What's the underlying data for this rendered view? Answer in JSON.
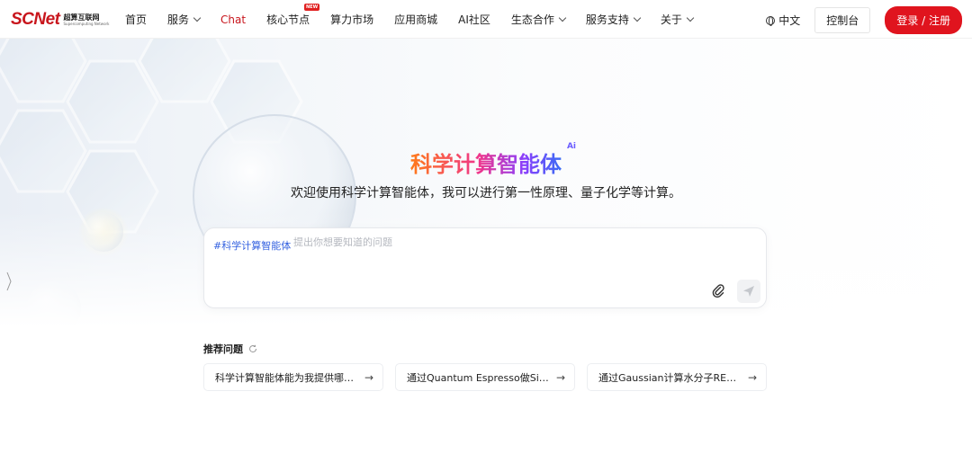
{
  "logo": {
    "main": "SCNet",
    "cn": "超算互联网",
    "en": "Supercomputing Network"
  },
  "nav": [
    {
      "label": "首页",
      "dropdown": false
    },
    {
      "label": "服务",
      "dropdown": true
    },
    {
      "label": "Chat",
      "dropdown": false,
      "active": true
    },
    {
      "label": "核心节点",
      "dropdown": false,
      "badge": "NEW"
    },
    {
      "label": "算力市场",
      "dropdown": false
    },
    {
      "label": "应用商城",
      "dropdown": false
    },
    {
      "label": "AI社区",
      "dropdown": false
    },
    {
      "label": "生态合作",
      "dropdown": true
    },
    {
      "label": "服务支持",
      "dropdown": true
    },
    {
      "label": "关于",
      "dropdown": true
    }
  ],
  "header_right": {
    "lang": "中文",
    "console": "控制台",
    "login": "登录 / 注册"
  },
  "hero": {
    "title": "科学计算智能体",
    "ai_mark": "Ai",
    "subtitle": "欢迎使用科学计算智能体，我可以进行第一性原理、量子化学等计算。"
  },
  "chat": {
    "tag": "#科学计算智能体",
    "placeholder": "提出你想要知道的问题",
    "value": ""
  },
  "recommend": {
    "title": "推荐问题",
    "items": [
      "科学计算智能体能为我提供哪些服务？",
      "通过Quantum Espresso做Si晶体的计算",
      "通过Gaussian计算水分子RESP电荷"
    ]
  },
  "colors": {
    "brand_red": "#c8161d",
    "login_red": "#e0141e",
    "tag_blue": "#3562e0"
  }
}
